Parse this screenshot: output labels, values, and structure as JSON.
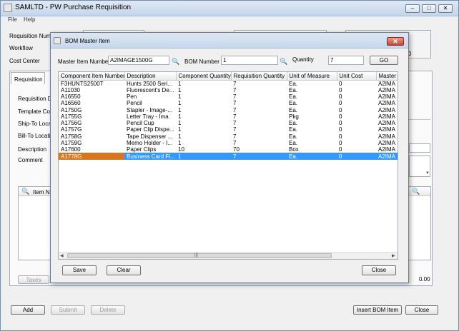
{
  "window": {
    "title": "SAMLTD - PW Purchase Requisition"
  },
  "menu": [
    "File",
    "Help"
  ],
  "main_form": {
    "labels": {
      "requisition_number": "Requisition Numb",
      "workflow": "Workflow",
      "cost_center": "Cost Center",
      "requisition_date": "Requisition D",
      "template_code": "Template Cod",
      "ship_to": "Ship-To Loca",
      "bill_to": "Bill-To Locati",
      "description": "Description",
      "comment": "Comment",
      "item_number_col": "Item Nu",
      "partial_right": "0",
      "total": "0.00"
    },
    "tab": "Requisition",
    "buttons": {
      "taxes": "Taxes",
      "add": "Add",
      "submit": "Submit",
      "delete": "Delete",
      "insert_bom": "Insert BOM Item",
      "close": "Close"
    }
  },
  "dialog": {
    "title": "BOM Master Item",
    "master_item_label": "Master Item Number",
    "master_item_value": "A2IMAGE1500G",
    "bom_number_label": "BOM Number",
    "bom_number_value": "1",
    "quantity_label": "Quantity",
    "quantity_value": "7",
    "go": "GO",
    "columns": [
      "Component Item Number",
      "Description",
      "Component Quantity",
      "Requisition Quantity",
      "Unit of Measure",
      "Unit Cost",
      "Master"
    ],
    "rows": [
      [
        "F3HUNTS2500T",
        "Hunts 2500 Seri...",
        "1",
        "7",
        "Ea.",
        "0",
        "A2IMA"
      ],
      [
        "A11030",
        "Fluorescent's De...",
        "1",
        "7",
        "Ea.",
        "0",
        "A2IMA"
      ],
      [
        "A16550",
        "Pen",
        "1",
        "7",
        "Ea.",
        "0",
        "A2IMA"
      ],
      [
        "A16560",
        "Pencil",
        "1",
        "7",
        "Ea.",
        "0",
        "A2IMA"
      ],
      [
        "A1750G",
        "Stapler - Image-...",
        "1",
        "7",
        "Ea.",
        "0",
        "A2IMA"
      ],
      [
        "A1755G",
        "Letter Tray - Ima",
        "1",
        "7",
        "Pkg",
        "0",
        "A2IMA"
      ],
      [
        "A1756G",
        "Pencil Cup",
        "1",
        "7",
        "Ea.",
        "0",
        "A2IMA"
      ],
      [
        "A1757G",
        "Paper Clip Dispe...",
        "1",
        "7",
        "Ea.",
        "0",
        "A2IMA"
      ],
      [
        "A1758G",
        "Tape Dispenser ...",
        "1",
        "7",
        "Ea.",
        "0",
        "A2IMA"
      ],
      [
        "A1759G",
        "Memo Holder - I...",
        "1",
        "7",
        "Ea.",
        "0",
        "A2IMA"
      ],
      [
        "A17600",
        "Paper Clips",
        "10",
        "70",
        "Box",
        "0",
        "A2IMA"
      ],
      [
        "A1778G",
        "Business Card Fi...",
        "1",
        "7",
        "Ea.",
        "0",
        "A2IMA"
      ]
    ],
    "selected_row": 11,
    "buttons": {
      "save": "Save",
      "clear": "Clear",
      "close": "Close"
    }
  },
  "colors": {
    "selection": "#3399ff",
    "selection_first_cell": "#d9751d"
  }
}
